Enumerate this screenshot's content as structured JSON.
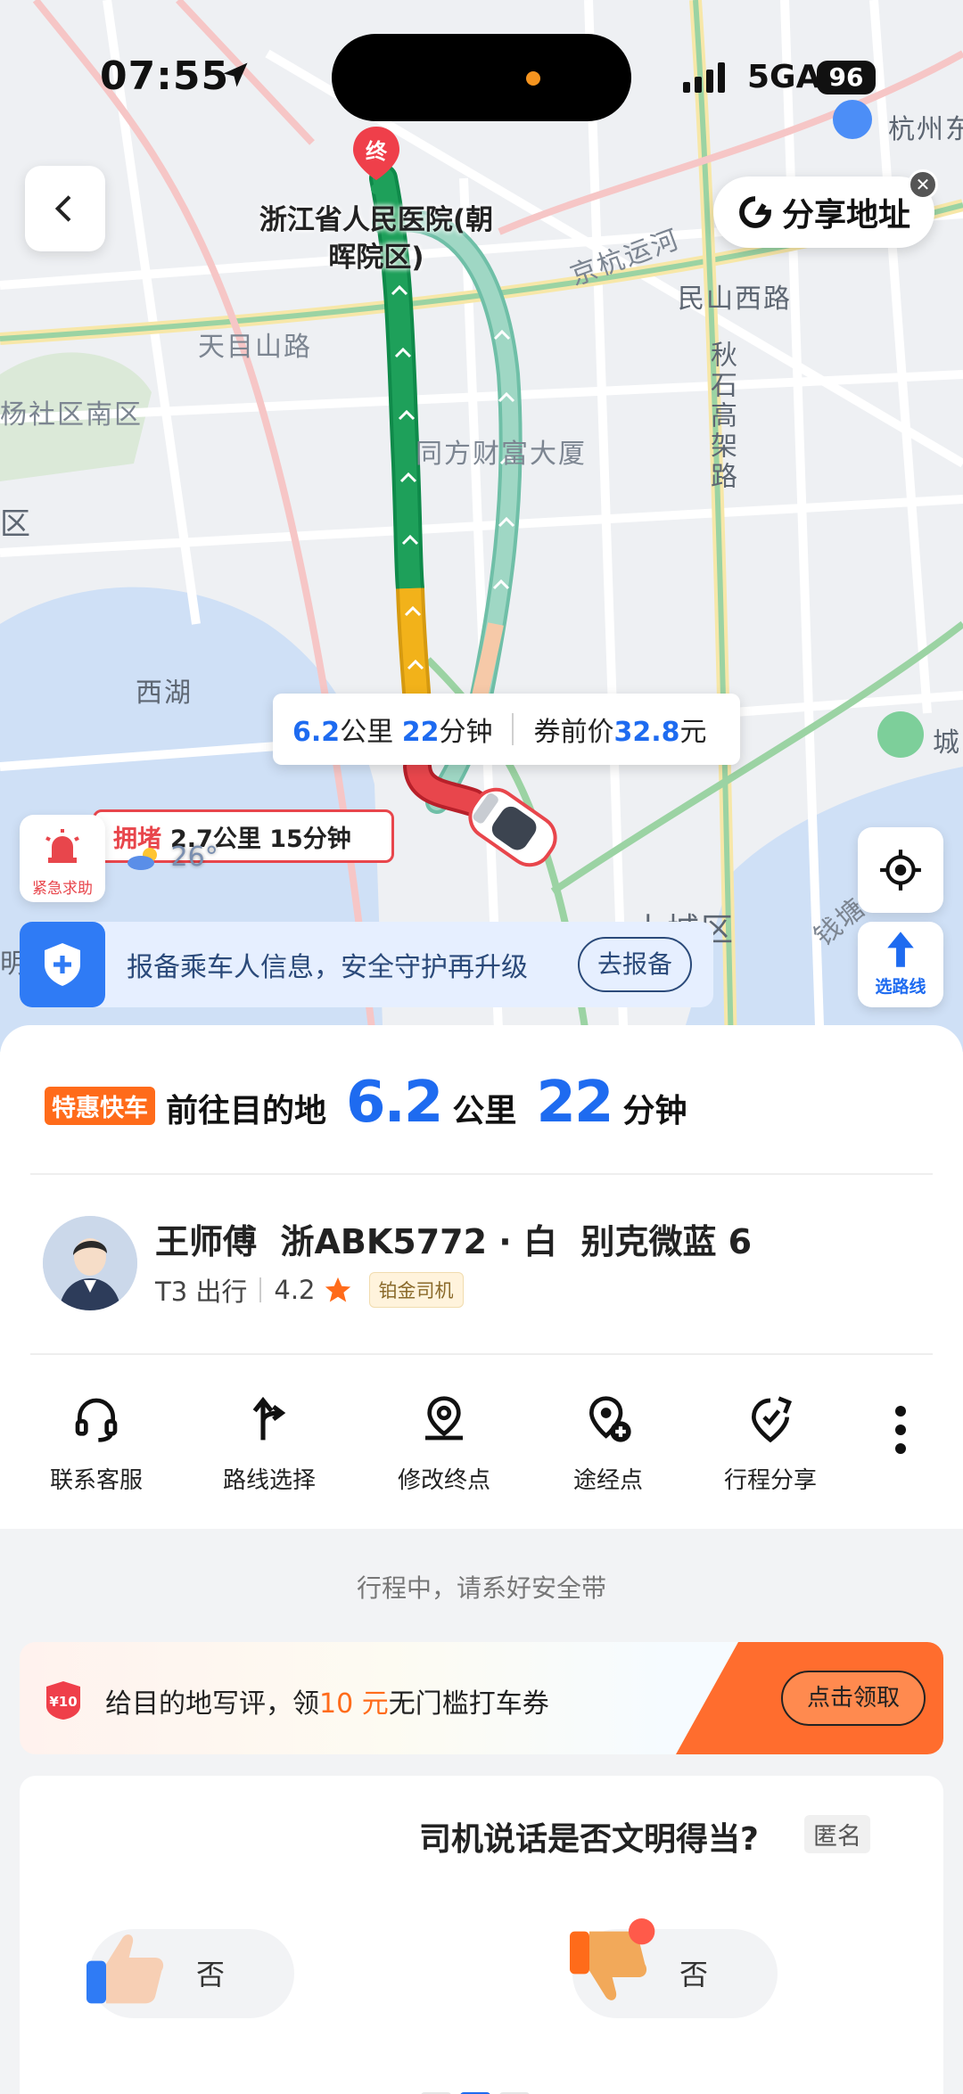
{
  "status_bar": {
    "time": "07:55",
    "network": "5GA",
    "battery": "96"
  },
  "map": {
    "share_label": "分享地址",
    "destination_marker": "终",
    "destination_name": "浙江省人民医院(朝晖院区)",
    "labels": {
      "tianmushan": "天目山路",
      "minshan": "民山西路",
      "jinghang": "京杭运河",
      "qiushi": "秋石高架路",
      "tongfang": "同方财富大厦",
      "xihu": "西湖",
      "community": "杨社区南区",
      "hangzhou": "杭州东",
      "shangcheng": "上城区",
      "qiantang": "钱塘",
      "cheng": "城",
      "qu": "区",
      "ming": "明"
    },
    "trip_summary": {
      "distance": "6.2",
      "distance_unit": "公里",
      "minutes": "22",
      "minutes_unit": "分钟",
      "price_label": "券前价",
      "price": "32.8",
      "price_unit": "元"
    },
    "congestion": {
      "tag": "拥堵",
      "text": "2.7公里 15分钟"
    },
    "weather_temp": "26°",
    "sos_label": "紧急求助",
    "route_select_label": "选路线",
    "safety_text": "报备乘车人信息，安全守护再升级",
    "safety_button": "去报备"
  },
  "trip_header": {
    "service_badge": "特惠快车",
    "to_label": "前往目的地",
    "distance": "6.2",
    "distance_unit": "公里",
    "minutes": "22",
    "minutes_unit": "分钟"
  },
  "driver": {
    "name": "王师傅",
    "plate": "浙ABK5772 · 白",
    "car": "别克微蓝 6",
    "company": "T3 出行",
    "rating": "4.2",
    "level": "铂金司机"
  },
  "actions": [
    {
      "label": "联系客服",
      "icon": "headset-icon"
    },
    {
      "label": "路线选择",
      "icon": "route-icon"
    },
    {
      "label": "修改终点",
      "icon": "location-edit-icon"
    },
    {
      "label": "途经点",
      "icon": "waypoint-add-icon"
    },
    {
      "label": "行程分享",
      "icon": "share-trip-icon"
    }
  ],
  "ride_note": "行程中，请系好安全带",
  "promo": {
    "coupon": "¥10",
    "text_before": "给目的地写评，领",
    "highlight": "10 元",
    "text_after": "无门槛打车券",
    "button": "点击领取"
  },
  "survey": {
    "question": "司机说话是否文明得当?",
    "anonymous": "匿名",
    "options": [
      "否",
      "否"
    ]
  },
  "colors": {
    "accent_blue": "#1e6bf0",
    "brand_orange": "#ff6b1a",
    "congestion_red": "#e8464c",
    "traffic_green": "#1ea05a",
    "traffic_yellow": "#f2b21a"
  }
}
